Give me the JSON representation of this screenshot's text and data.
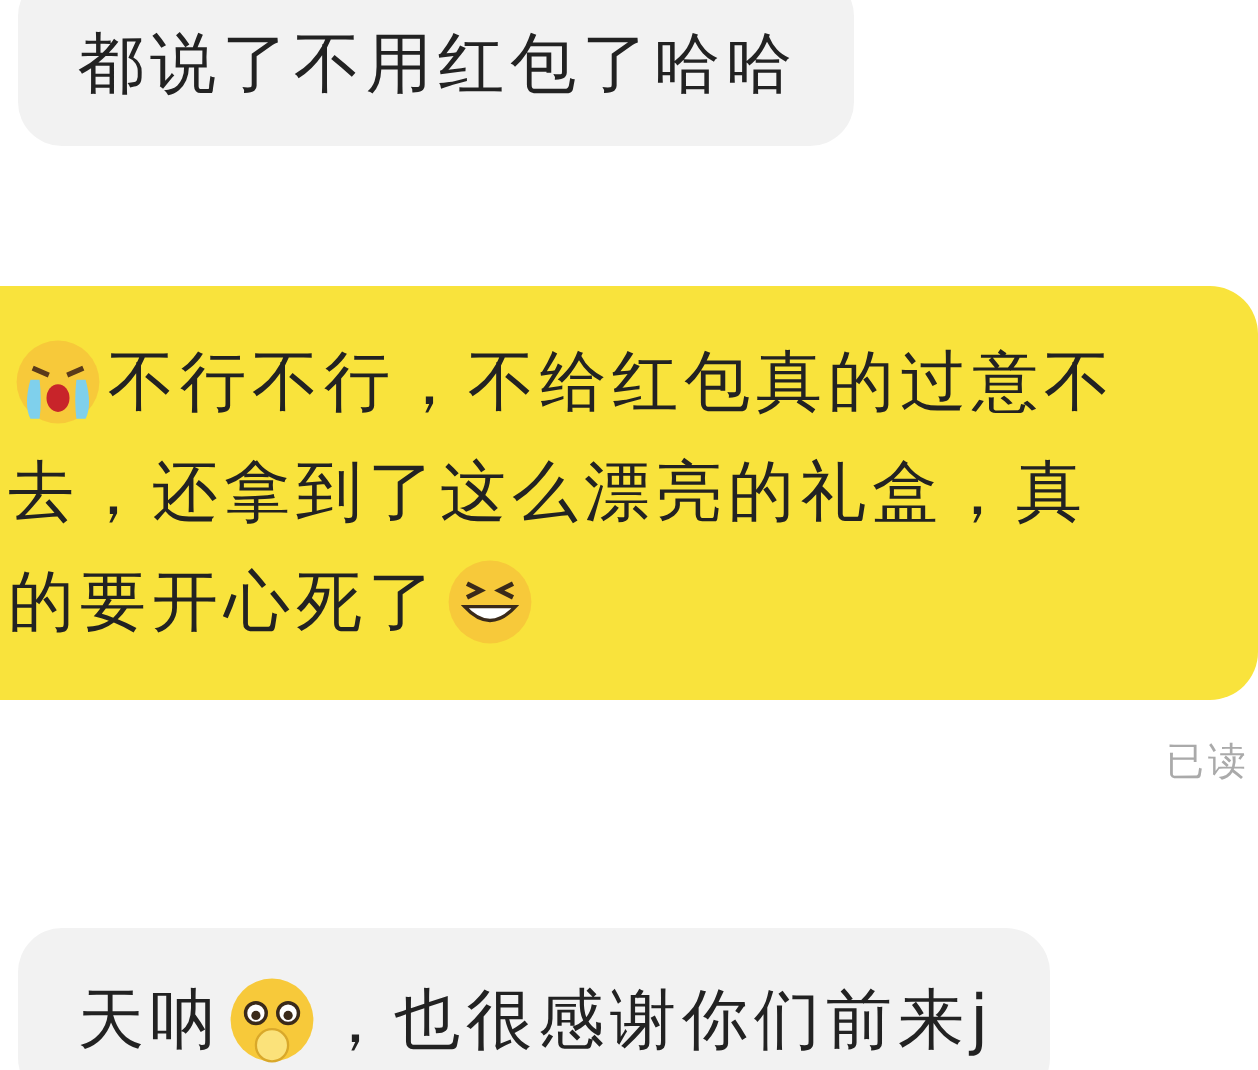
{
  "messages": [
    {
      "outgoing": false,
      "lines": [
        [
          {
            "kind": "text",
            "text": "都说了不用红包了哈哈"
          }
        ]
      ]
    },
    {
      "outgoing": true,
      "status": "已读",
      "lines": [
        [
          {
            "kind": "cry"
          },
          {
            "kind": "text",
            "text": "不行不行，不给红包真的过意不"
          }
        ],
        [
          {
            "kind": "text",
            "text": "去，还拿到了这么漂亮的礼盒，真"
          }
        ],
        [
          {
            "kind": "text",
            "text": "的要开心死了"
          },
          {
            "kind": "grin"
          }
        ]
      ]
    },
    {
      "outgoing": false,
      "lines": [
        [
          {
            "kind": "text",
            "text": "天呐"
          },
          {
            "kind": "gasp"
          },
          {
            "kind": "text",
            "text": "，也很感谢你们前来j"
          }
        ]
      ]
    }
  ]
}
